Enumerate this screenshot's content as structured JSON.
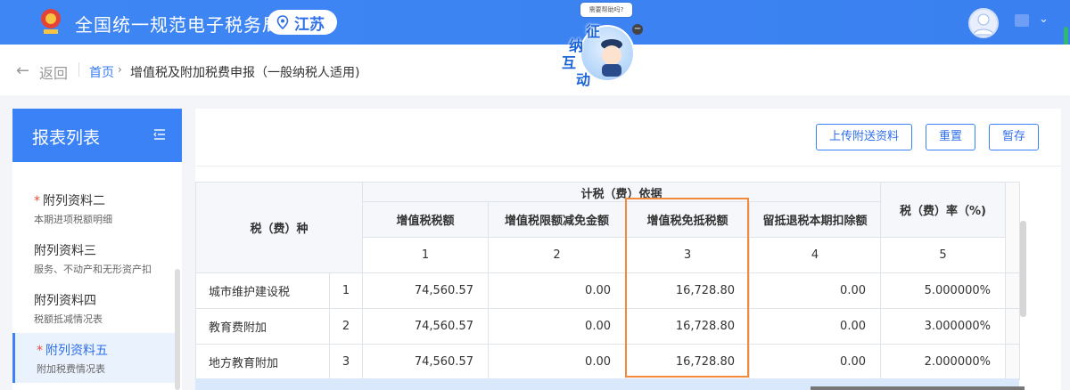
{
  "header": {
    "brand_title": "全国统一规范电子税务局",
    "region": "江苏"
  },
  "breadcrumb": {
    "back_label": "返回",
    "home": "首页",
    "current": "增值税及附加税费申报（一般纳税人适用)"
  },
  "mascot": {
    "bubble": "需要帮助吗?",
    "chars": [
      "征",
      "纳",
      "互",
      "动"
    ]
  },
  "sidebar": {
    "title": "报表列表",
    "items": [
      {
        "label": "附列资料二",
        "sub": "本期进项税额明细",
        "required": "*"
      },
      {
        "label": "附列资料三",
        "sub": "服务、不动产和无形资产扣",
        "required": ""
      },
      {
        "label": "附列资料四",
        "sub": "税额抵减情况表",
        "required": ""
      },
      {
        "label": "附列资料五",
        "sub": "附加税费情况表",
        "required": "*"
      }
    ]
  },
  "toolbar": {
    "upload_label": "上传附送资料",
    "reset_label": "重置",
    "save_label": "暂存"
  },
  "table": {
    "group_header": "计税（费）依据",
    "tax_type_header": "税（费）种",
    "rate_header": "税（费）率（%)",
    "columns": [
      "增值税税额",
      "增值税限额减免金额",
      "增值税免抵税额",
      "留抵退税本期扣除额"
    ],
    "column_numbers": [
      "1",
      "2",
      "3",
      "4",
      "5"
    ],
    "rows": [
      {
        "name": "城市维护建设税",
        "index": "1",
        "vat": "74,560.57",
        "limit_relief": "0.00",
        "exempt_credit": "16,728.80",
        "refund_deduct": "0.00",
        "rate": "5.000000%"
      },
      {
        "name": "教育费附加",
        "index": "2",
        "vat": "74,560.57",
        "limit_relief": "0.00",
        "exempt_credit": "16,728.80",
        "refund_deduct": "0.00",
        "rate": "3.000000%"
      },
      {
        "name": "地方教育附加",
        "index": "3",
        "vat": "74,560.57",
        "limit_relief": "0.00",
        "exempt_credit": "16,728.80",
        "refund_deduct": "0.00",
        "rate": "2.000000%"
      }
    ]
  },
  "colors": {
    "primary": "#3b82f6",
    "highlight": "#f28a3c",
    "required": "#e74c3c"
  }
}
